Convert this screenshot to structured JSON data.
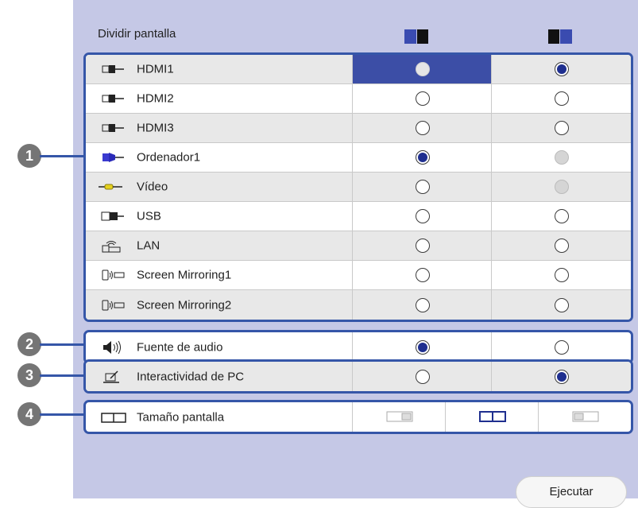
{
  "title": "Dividir pantalla",
  "header_icons": [
    "split-left-active-icon",
    "split-right-active-icon"
  ],
  "sources": [
    {
      "icon": "hdmi-icon",
      "label": "HDMI1",
      "left": "off",
      "right": "on",
      "left_selected": true
    },
    {
      "icon": "hdmi-icon",
      "label": "HDMI2",
      "left": "empty",
      "right": "empty"
    },
    {
      "icon": "hdmi-icon",
      "label": "HDMI3",
      "left": "empty",
      "right": "empty"
    },
    {
      "icon": "vga-computer-icon",
      "label": "Ordenador1",
      "left": "on",
      "right": "grey"
    },
    {
      "icon": "video-cable-icon",
      "label": "Vídeo",
      "left": "empty",
      "right": "grey"
    },
    {
      "icon": "usb-icon",
      "label": "USB",
      "left": "empty",
      "right": "empty"
    },
    {
      "icon": "lan-icon",
      "label": "LAN",
      "left": "empty",
      "right": "empty"
    },
    {
      "icon": "screen-mirroring-icon",
      "label": "Screen Mirroring1",
      "left": "empty",
      "right": "empty"
    },
    {
      "icon": "screen-mirroring-icon",
      "label": "Screen Mirroring2",
      "left": "empty",
      "right": "empty"
    }
  ],
  "audio": {
    "icon": "speaker-icon",
    "label": "Fuente de audio",
    "left": "on",
    "right": "empty"
  },
  "interactive": {
    "icon": "pen-screen-icon",
    "label": "Interactividad de PC",
    "left": "empty",
    "right": "on"
  },
  "size": {
    "icon": "screen-size-icon",
    "label": "Tamaño pantalla",
    "options": [
      "left-larger",
      "equal",
      "right-larger"
    ],
    "selected": "equal"
  },
  "callouts": [
    "1",
    "2",
    "3",
    "4"
  ],
  "execute_label": "Ejecutar",
  "colors": {
    "panel": "#c5c8e6",
    "border": "#3556a8",
    "selected_cell": "#3c4ea6",
    "radio_on": "#1f2f8f",
    "callout": "#757575"
  }
}
